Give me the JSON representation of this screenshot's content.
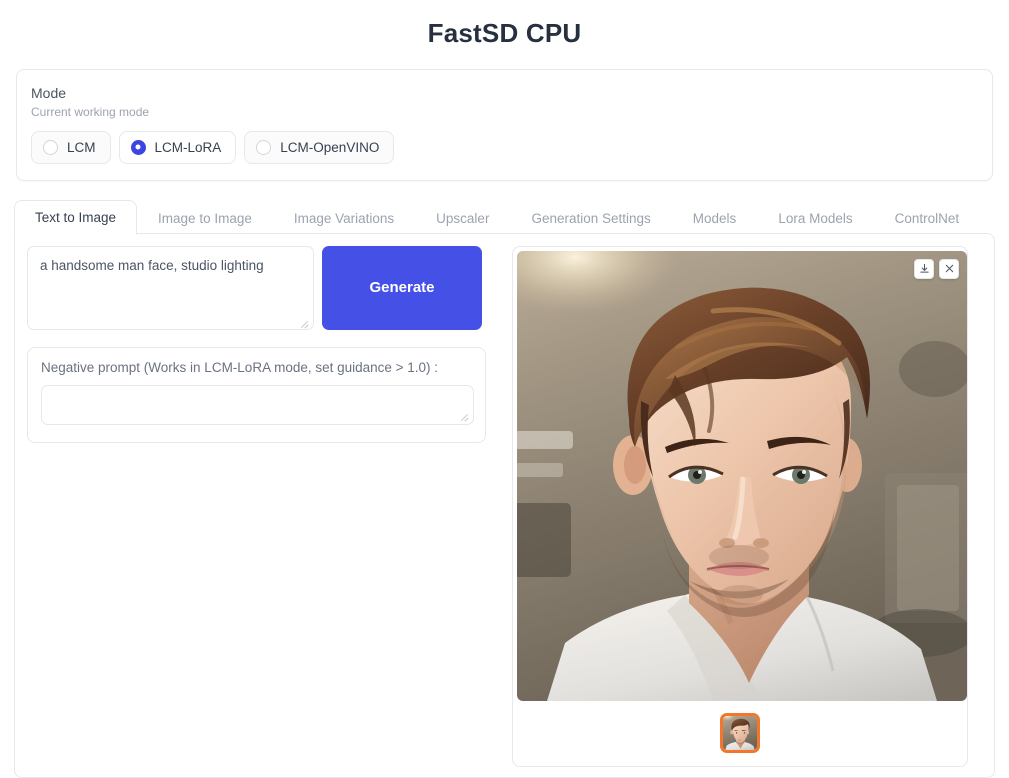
{
  "app": {
    "title": "FastSD CPU"
  },
  "mode": {
    "label": "Mode",
    "sublabel": "Current working mode",
    "options": [
      {
        "label": "LCM",
        "selected": false
      },
      {
        "label": "LCM-LoRA",
        "selected": true
      },
      {
        "label": "LCM-OpenVINO",
        "selected": false
      }
    ],
    "selected_value": "LCM-LoRA",
    "accent_color": "#3b45e0"
  },
  "tabs": [
    {
      "label": "Text to Image",
      "active": true
    },
    {
      "label": "Image to Image",
      "active": false
    },
    {
      "label": "Image Variations",
      "active": false
    },
    {
      "label": "Upscaler",
      "active": false
    },
    {
      "label": "Generation Settings",
      "active": false
    },
    {
      "label": "Models",
      "active": false
    },
    {
      "label": "Lora Models",
      "active": false
    },
    {
      "label": "ControlNet",
      "active": false
    }
  ],
  "text_to_image": {
    "prompt": {
      "value": "a handsome man face, studio lighting",
      "placeholder": ""
    },
    "generate_button": {
      "label": "Generate",
      "color": "#4550e6"
    },
    "negative_prompt": {
      "label": "Negative prompt (Works in LCM-LoRA mode, set guidance > 1.0) :",
      "value": "",
      "placeholder": ""
    }
  },
  "output": {
    "image_actions": [
      {
        "name": "download-icon",
        "glyph": "download"
      },
      {
        "name": "close-icon",
        "glyph": "close"
      }
    ],
    "gallery": {
      "thumbnails": [
        {
          "selected": true,
          "border_color": "#f4762a"
        }
      ]
    },
    "image_description": "AI generated portrait of a young man with brown hair and stubble in a white t-shirt, studio lighting, blurred interior background"
  }
}
